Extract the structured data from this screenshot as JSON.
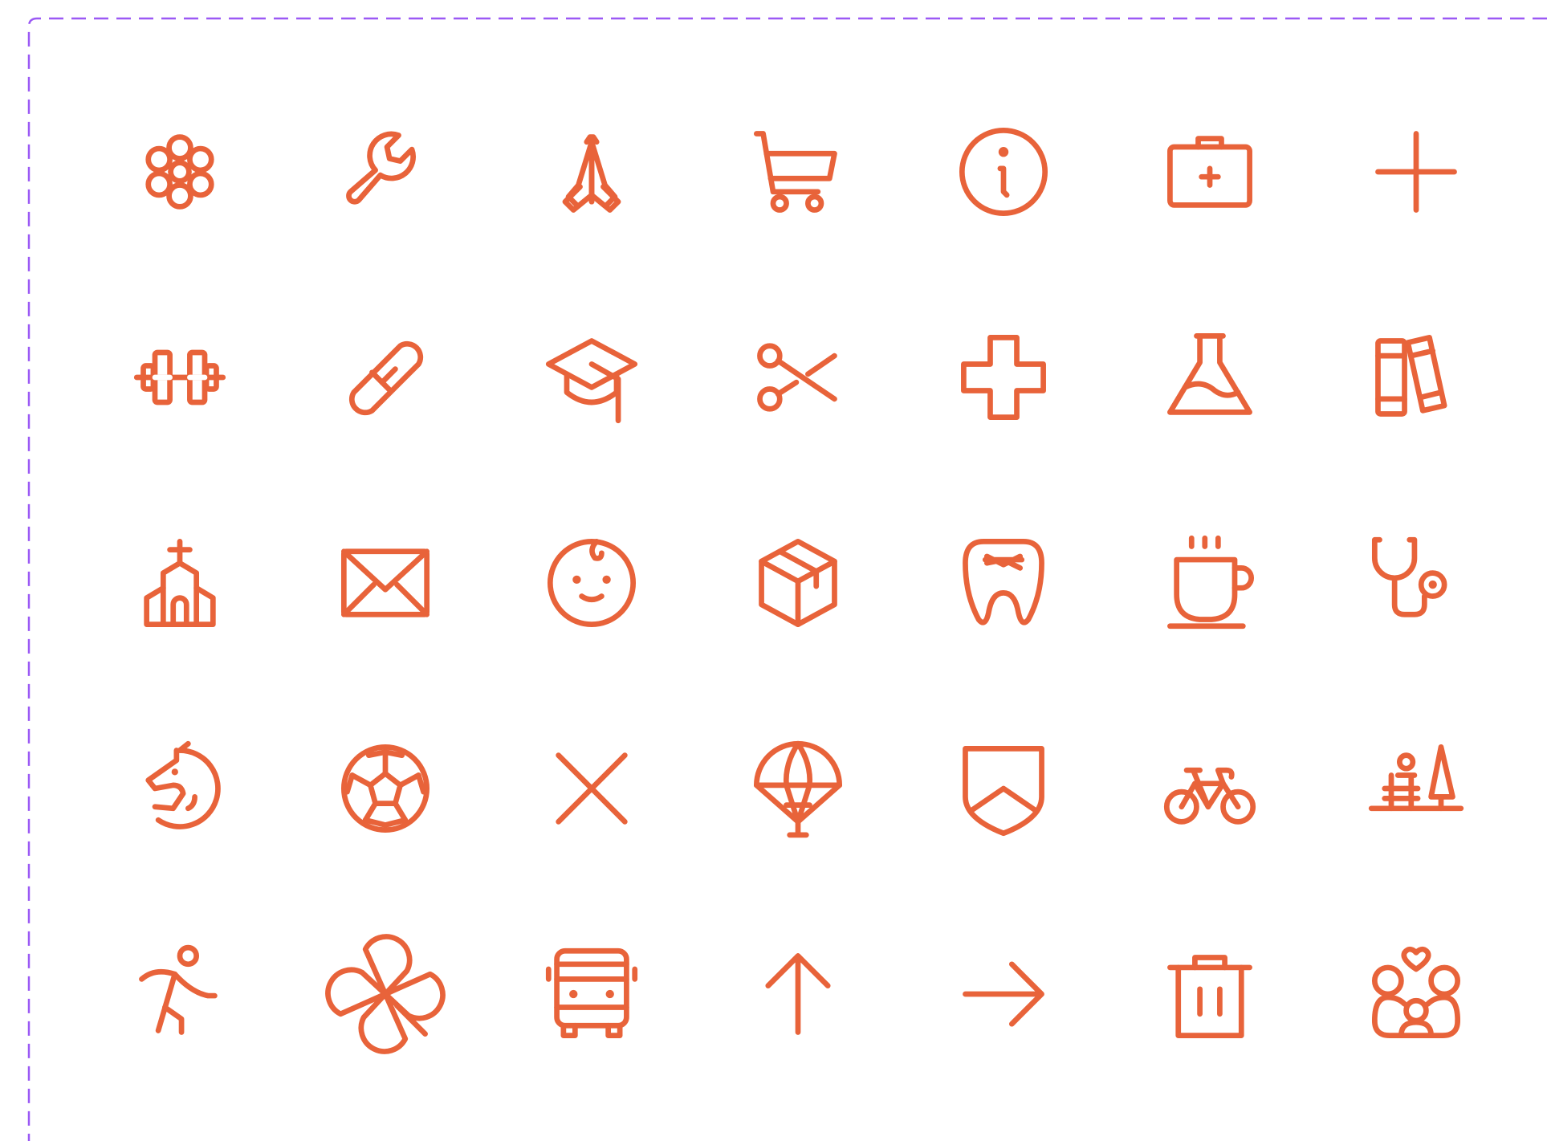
{
  "colors": {
    "icon": "#E8633A",
    "frame_border": "#9B59F5",
    "background": "#FFFFFF"
  },
  "icons": [
    "flower-icon",
    "wrench-icon",
    "praying-hands-icon",
    "shopping-cart-icon",
    "info-icon",
    "first-aid-kit-icon",
    "plus-icon",
    "dumbbell-icon",
    "bandage-icon",
    "graduation-cap-icon",
    "scissors-icon",
    "medical-cross-icon",
    "flask-icon",
    "books-icon",
    "church-icon",
    "envelope-icon",
    "baby-face-icon",
    "box-icon",
    "tooth-icon",
    "coffee-cup-icon",
    "stethoscope-icon",
    "horse-icon",
    "soccer-ball-icon",
    "close-icon",
    "parachute-icon",
    "shield-icon",
    "bicycle-icon",
    "park-icon",
    "walking-person-icon",
    "pinwheel-icon",
    "bus-icon",
    "arrow-up-icon",
    "arrow-right-icon",
    "trash-icon",
    "family-icon"
  ]
}
